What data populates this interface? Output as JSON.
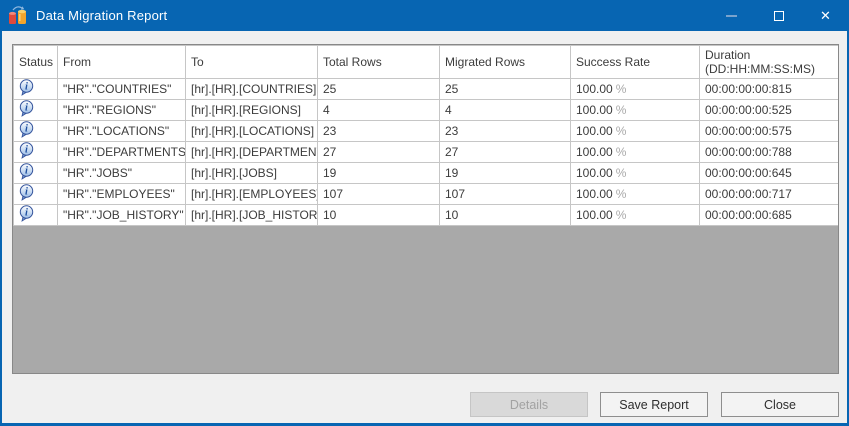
{
  "window": {
    "title": "Data Migration Report",
    "icons": {
      "app": "data-migration-app-icon",
      "minimize": "–",
      "maximize": "▢",
      "close": "✕",
      "row_status": "info-balloon"
    }
  },
  "colors": {
    "titlebar_blue": "#0765b2",
    "body_gray": "#f0f0f0",
    "grid_empty_gray": "#a9a9a9",
    "info_icon_blue": "#2b56a7",
    "disabled_text": "#a2a2a2"
  },
  "table": {
    "columns": [
      {
        "label": "Status"
      },
      {
        "label": "From"
      },
      {
        "label": "To"
      },
      {
        "label": "Total Rows"
      },
      {
        "label": "Migrated Rows"
      },
      {
        "label": "Success Rate"
      },
      {
        "label": "Duration",
        "sublabel": "(DD:HH:MM:SS:MS)"
      }
    ],
    "rows": [
      {
        "status": "info",
        "from": "\"HR\".\"COUNTRIES\"",
        "to": "[hr].[HR].[COUNTRIES]",
        "total_rows": "25",
        "migrated_rows": "25",
        "success_rate": "100.00",
        "success_unit": "%",
        "duration": "00:00:00:00:815"
      },
      {
        "status": "info",
        "from": "\"HR\".\"REGIONS\"",
        "to": "[hr].[HR].[REGIONS]",
        "total_rows": "4",
        "migrated_rows": "4",
        "success_rate": "100.00",
        "success_unit": "%",
        "duration": "00:00:00:00:525"
      },
      {
        "status": "info",
        "from": "\"HR\".\"LOCATIONS\"",
        "to": "[hr].[HR].[LOCATIONS]",
        "total_rows": "23",
        "migrated_rows": "23",
        "success_rate": "100.00",
        "success_unit": "%",
        "duration": "00:00:00:00:575"
      },
      {
        "status": "info",
        "from": "\"HR\".\"DEPARTMENTS\"",
        "to": "[hr].[HR].[DEPARTMENTS]",
        "total_rows": "27",
        "migrated_rows": "27",
        "success_rate": "100.00",
        "success_unit": "%",
        "duration": "00:00:00:00:788"
      },
      {
        "status": "info",
        "from": "\"HR\".\"JOBS\"",
        "to": "[hr].[HR].[JOBS]",
        "total_rows": "19",
        "migrated_rows": "19",
        "success_rate": "100.00",
        "success_unit": "%",
        "duration": "00:00:00:00:645"
      },
      {
        "status": "info",
        "from": "\"HR\".\"EMPLOYEES\"",
        "to": "[hr].[HR].[EMPLOYEES]",
        "total_rows": "107",
        "migrated_rows": "107",
        "success_rate": "100.00",
        "success_unit": "%",
        "duration": "00:00:00:00:717"
      },
      {
        "status": "info",
        "from": "\"HR\".\"JOB_HISTORY\"",
        "to": "[hr].[HR].[JOB_HISTORY]",
        "total_rows": "10",
        "migrated_rows": "10",
        "success_rate": "100.00",
        "success_unit": "%",
        "duration": "00:00:00:00:685"
      }
    ]
  },
  "footer": {
    "details_label": "Details",
    "save_report_label": "Save Report",
    "close_label": "Close"
  }
}
